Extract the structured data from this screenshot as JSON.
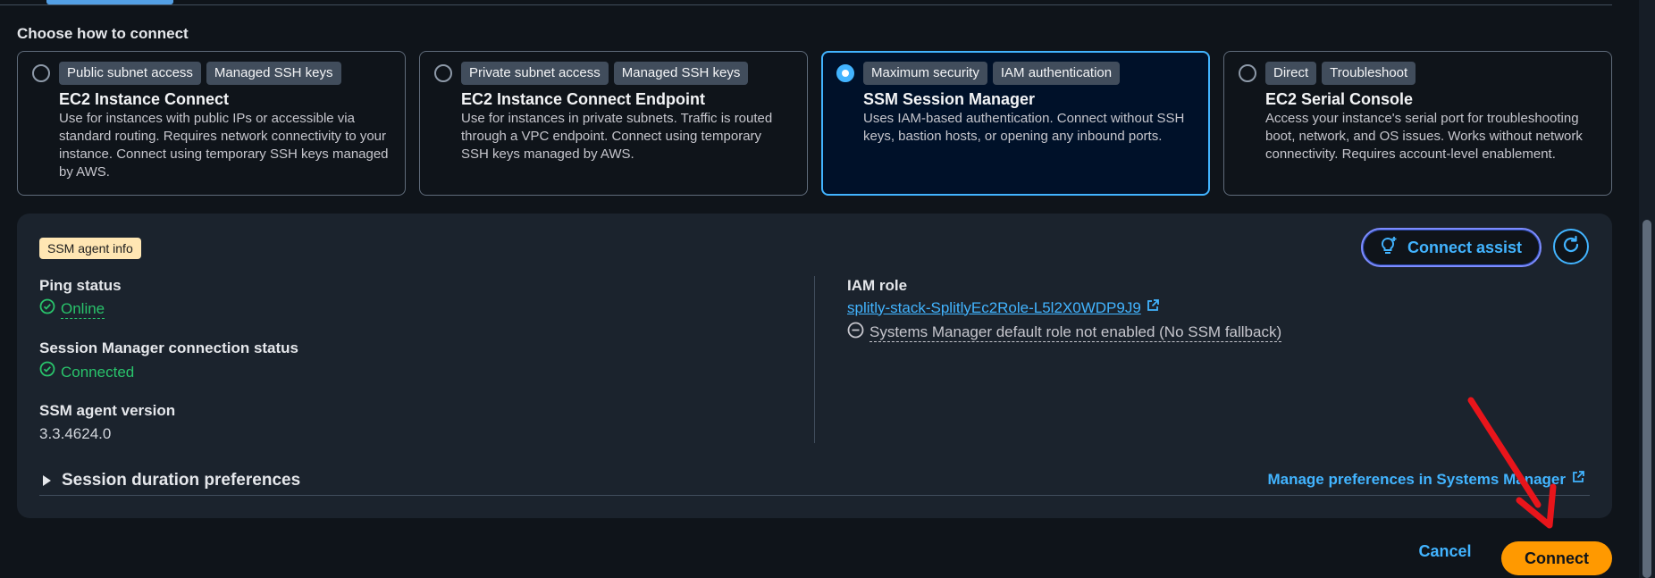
{
  "section_title": "Choose how to connect",
  "methods": [
    {
      "badges": [
        "Public subnet access",
        "Managed SSH keys"
      ],
      "title": "EC2 Instance Connect",
      "description": "Use for instances with public IPs or accessible via standard routing. Requires network connectivity to your instance. Connect using temporary SSH keys managed by AWS.",
      "selected": false
    },
    {
      "badges": [
        "Private subnet access",
        "Managed SSH keys"
      ],
      "title": "EC2 Instance Connect Endpoint",
      "description": "Use for instances in private subnets. Traffic is routed through a VPC endpoint. Connect using temporary SSH keys managed by AWS.",
      "selected": false
    },
    {
      "badges": [
        "Maximum security",
        "IAM authentication"
      ],
      "title": "SSM Session Manager",
      "description": "Uses IAM-based authentication. Connect without SSH keys, bastion hosts, or opening any inbound ports.",
      "selected": true
    },
    {
      "badges": [
        "Direct",
        "Troubleshoot"
      ],
      "title": "EC2 Serial Console",
      "description": "Access your instance's serial port for troubleshooting boot, network, and OS issues. Works without network connectivity. Requires account-level enablement.",
      "selected": false
    }
  ],
  "agent": {
    "badge": "SSM agent info",
    "connect_assist": "Connect assist",
    "ping_label": "Ping status",
    "ping_value": "Online",
    "session_label": "Session Manager connection status",
    "session_value": "Connected",
    "version_label": "SSM agent version",
    "version_value": "3.3.4624.0",
    "iam_label": "IAM role",
    "iam_value": "splitly-stack-SplitlyEc2Role-L5l2X0WDP9J9",
    "iam_note": "Systems Manager default role not enabled (No SSM fallback)",
    "preferences_label": "Session duration preferences",
    "manage_link": "Manage preferences in Systems Manager"
  },
  "footer": {
    "cancel": "Cancel",
    "connect": "Connect"
  },
  "colors": {
    "accent": "#42b4ff",
    "primary_button": "#ff9900",
    "success": "#29c36b",
    "badge_warning": "#ffe6b3",
    "annotation_arrow": "#e8151b"
  }
}
